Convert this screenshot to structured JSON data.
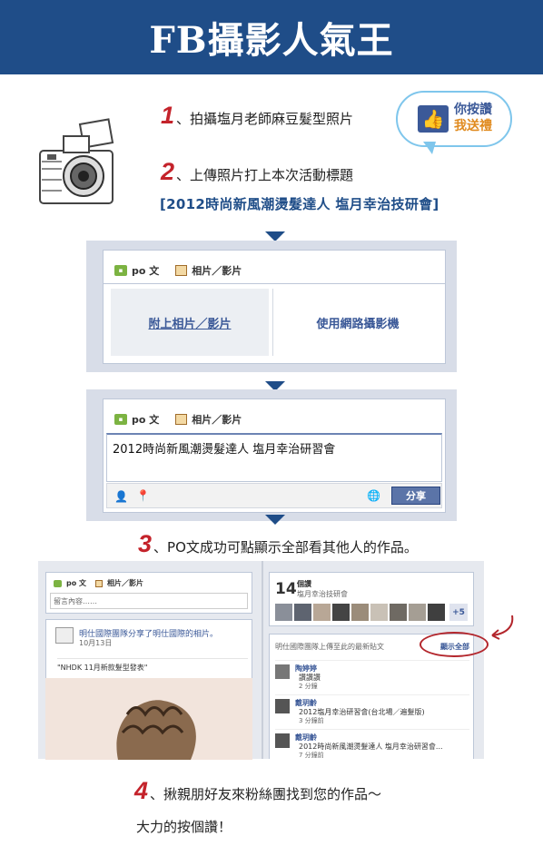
{
  "header": {
    "title": "FB攝影人氣王"
  },
  "steps": [
    {
      "num": "1",
      "text": "、拍攝塩月老師麻豆髮型照片"
    },
    {
      "num": "2",
      "text": "、上傳照片打上本次活動標題"
    },
    {
      "num": "3",
      "text": "、PO文成功可點顯示全部看其他人的作品。"
    },
    {
      "num": "4",
      "text": "、揪親朋好友來粉絲團找到您的作品～"
    }
  ],
  "step4_line2": "大力的按個讚！",
  "hashtag": "[2012時尚新風潮燙髮達人  塩月幸治技研會]",
  "bubble": {
    "line1": "你按讚",
    "line2": "我送禮"
  },
  "fb_tabs": {
    "post": "po 文",
    "photo": "相片／影片"
  },
  "panel1": {
    "upload": "附上相片／影片",
    "webcam": "使用網路攝影機"
  },
  "panel2": {
    "input_value": "2012時尚新風潮燙髮達人 塩月幸治研習會",
    "share": "分享"
  },
  "panel3": {
    "post_placeholder": "留言內容……",
    "feed_title": "明仕國際團隊分享了明仕國際的相片。",
    "feed_date": "10月13日",
    "feed_caption": "\"NHDK 11月新款髮型發表\"",
    "likes_count": "14",
    "likes_label": "個讚",
    "likes_sub": "塩月幸治技研會",
    "more_count": "+5",
    "section_title": "明仕國際團隊上傳至此的最新貼文",
    "show_all": "顯示全部",
    "posts": [
      {
        "name": "陶婷婷",
        "text": "讚讚讚",
        "meta": "2 分鐘"
      },
      {
        "name": "戴玥齡",
        "text": "2012塩月幸治研習會(台北場／遍髮版)",
        "meta": "3 分鐘前"
      },
      {
        "name": "戴玥齡",
        "text": "2012時尚新風潮燙髮達人 塩月幸治研習會...",
        "meta": "7 分鐘前"
      }
    ]
  },
  "colors": {
    "header_bg": "#1f4d88",
    "step_red": "#c4232b",
    "fb_blue": "#3b5998",
    "panel_bg": "#d8dde8"
  }
}
